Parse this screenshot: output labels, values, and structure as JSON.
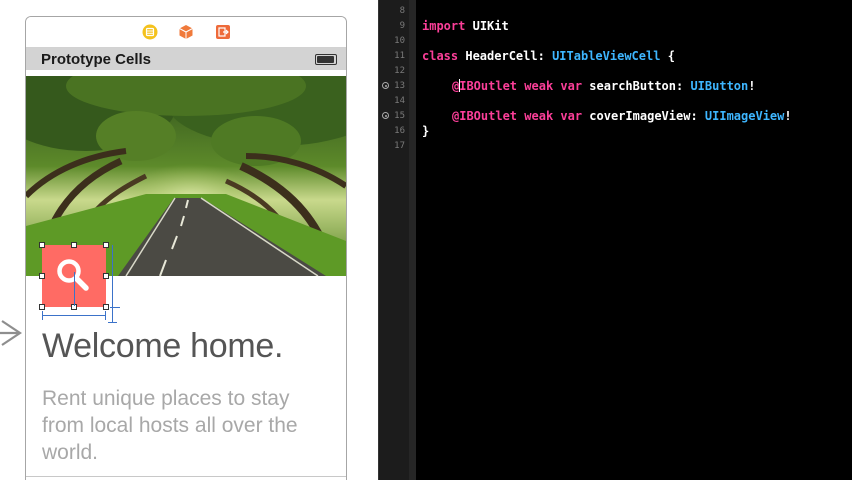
{
  "storyboard": {
    "nav_title": "Prototype Cells",
    "dock_icons": [
      "view-controller-icon",
      "first-responder-icon",
      "exit-icon"
    ],
    "welcome_text": "Welcome home.",
    "subtitle_text": "Rent unique places to stay from local hosts all over the world.",
    "search_button_icon": "magnifying-glass-icon",
    "accent_colors": {
      "search_button": "#ff6b64",
      "constraint": "#3b72c9"
    }
  },
  "editor": {
    "line_numbers": [
      "8",
      "9",
      "10",
      "11",
      "12",
      "13",
      "14",
      "15",
      "16",
      "17"
    ],
    "code": {
      "import_kw": "import",
      "import_module": "UIKit",
      "class_kw": "class",
      "class_name": "HeaderCell:",
      "superclass": "UITableViewCell",
      "open_brace": "{",
      "outlet1_attr": "@IBOutlet",
      "outlet1_rest": "IBOutlet",
      "outlet1_mods": "weak var",
      "outlet1_name": "searchButton:",
      "outlet1_type": "UIButton",
      "outlet1_bang": "!",
      "outlet2_attr": "@IBOutlet",
      "outlet2_mods": "weak var",
      "outlet2_name": "coverImageView:",
      "outlet2_type": "UIImageView",
      "outlet2_bang": "!",
      "close_brace": "}"
    },
    "colors": {
      "keyword": "#fc3f99",
      "type": "#3eb6ff",
      "background": "#000000"
    }
  }
}
